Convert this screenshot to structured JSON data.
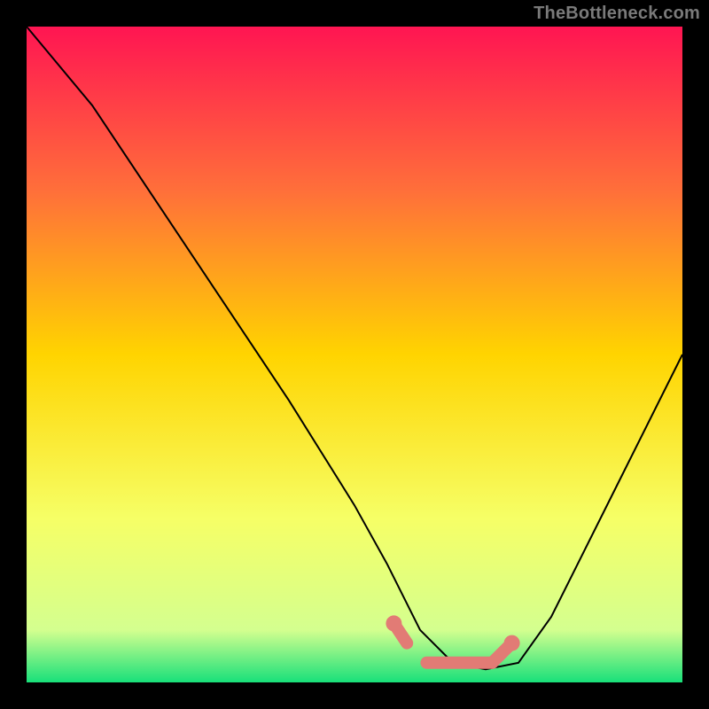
{
  "watermark": "TheBottleneck.com",
  "chart_data": {
    "type": "line",
    "title": "",
    "xlabel": "",
    "ylabel": "",
    "xlim": [
      0,
      100
    ],
    "ylim": [
      0,
      100
    ],
    "x": [
      0,
      10,
      20,
      30,
      40,
      50,
      55,
      60,
      65,
      70,
      75,
      80,
      90,
      100
    ],
    "values": [
      100,
      88,
      73,
      58,
      43,
      27,
      18,
      8,
      3,
      2,
      3,
      10,
      30,
      50
    ],
    "gradient_stops": [
      {
        "offset": 0,
        "color": "#ff1552"
      },
      {
        "offset": 25,
        "color": "#ff6f3a"
      },
      {
        "offset": 50,
        "color": "#ffd400"
      },
      {
        "offset": 75,
        "color": "#f6ff66"
      },
      {
        "offset": 92,
        "color": "#d4ff8f"
      },
      {
        "offset": 100,
        "color": "#18e07a"
      }
    ],
    "highlight": {
      "color": "#e27b75",
      "segments": [
        {
          "x0": 56,
          "y0": 9,
          "x1": 58,
          "y1": 6
        },
        {
          "x0": 61,
          "y0": 3,
          "x1": 71,
          "y1": 3
        },
        {
          "x0": 71,
          "y0": 3,
          "x1": 74,
          "y1": 6
        }
      ],
      "dots": [
        {
          "x": 56,
          "y": 9
        },
        {
          "x": 74,
          "y": 6
        }
      ]
    }
  }
}
